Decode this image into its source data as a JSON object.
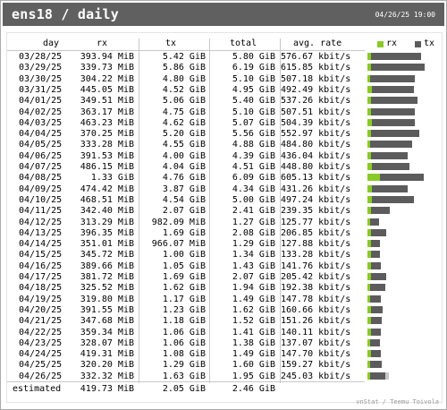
{
  "header": {
    "title": "ens18 / daily",
    "timestamp": "04/26/25 19:00"
  },
  "columns": {
    "day": "day",
    "rx": "rx",
    "tx": "tx",
    "total": "total",
    "avg_rate": "avg. rate"
  },
  "legend": {
    "rx": "rx",
    "tx": "tx",
    "rx_color": "#8aca28",
    "tx_color": "#5c5c5c"
  },
  "rows": [
    {
      "day": "03/28/25",
      "rx": "393.94 MiB",
      "tx": "5.42 GiB",
      "total": "5.80 GiB",
      "rate": "576.67 kbit/s",
      "rx_frac": 0.034,
      "tx_frac": 0.46
    },
    {
      "day": "03/29/25",
      "rx": "339.73 MiB",
      "tx": "5.86 GiB",
      "total": "6.19 GiB",
      "rate": "615.85 kbit/s",
      "rx_frac": 0.029,
      "tx_frac": 0.5
    },
    {
      "day": "03/30/25",
      "rx": "304.22 MiB",
      "tx": "4.80 GiB",
      "total": "5.10 GiB",
      "rate": "507.18 kbit/s",
      "rx_frac": 0.026,
      "tx_frac": 0.41
    },
    {
      "day": "03/31/25",
      "rx": "445.05 MiB",
      "tx": "4.52 GiB",
      "total": "4.95 GiB",
      "rate": "492.49 kbit/s",
      "rx_frac": 0.038,
      "tx_frac": 0.385
    },
    {
      "day": "04/01/25",
      "rx": "349.51 MiB",
      "tx": "5.06 GiB",
      "total": "5.40 GiB",
      "rate": "537.26 kbit/s",
      "rx_frac": 0.03,
      "tx_frac": 0.43
    },
    {
      "day": "04/02/25",
      "rx": "363.17 MiB",
      "tx": "4.75 GiB",
      "total": "5.10 GiB",
      "rate": "507.51 kbit/s",
      "rx_frac": 0.031,
      "tx_frac": 0.405
    },
    {
      "day": "04/03/25",
      "rx": "463.23 MiB",
      "tx": "4.62 GiB",
      "total": "5.07 GiB",
      "rate": "504.39 kbit/s",
      "rx_frac": 0.039,
      "tx_frac": 0.394
    },
    {
      "day": "04/04/25",
      "rx": "370.25 MiB",
      "tx": "5.20 GiB",
      "total": "5.56 GiB",
      "rate": "552.97 kbit/s",
      "rx_frac": 0.032,
      "tx_frac": 0.443
    },
    {
      "day": "04/05/25",
      "rx": "333.28 MiB",
      "tx": "4.55 GiB",
      "total": "4.88 GiB",
      "rate": "484.80 kbit/s",
      "rx_frac": 0.028,
      "tx_frac": 0.388
    },
    {
      "day": "04/06/25",
      "rx": "391.53 MiB",
      "tx": "4.00 GiB",
      "total": "4.39 GiB",
      "rate": "436.04 kbit/s",
      "rx_frac": 0.033,
      "tx_frac": 0.341
    },
    {
      "day": "04/07/25",
      "rx": "486.15 MiB",
      "tx": "4.04 GiB",
      "total": "4.51 GiB",
      "rate": "448.80 kbit/s",
      "rx_frac": 0.041,
      "tx_frac": 0.344
    },
    {
      "day": "04/08/25",
      "rx": "1.33 GiB",
      "tx": "4.76 GiB",
      "total": "6.09 GiB",
      "rate": "605.13 kbit/s",
      "rx_frac": 0.113,
      "tx_frac": 0.406
    },
    {
      "day": "04/09/25",
      "rx": "474.42 MiB",
      "tx": "3.87 GiB",
      "total": "4.34 GiB",
      "rate": "431.26 kbit/s",
      "rx_frac": 0.04,
      "tx_frac": 0.33
    },
    {
      "day": "04/10/25",
      "rx": "468.51 MiB",
      "tx": "4.54 GiB",
      "total": "5.00 GiB",
      "rate": "497.24 kbit/s",
      "rx_frac": 0.04,
      "tx_frac": 0.387
    },
    {
      "day": "04/11/25",
      "rx": "342.40 MiB",
      "tx": "2.07 GiB",
      "total": "2.41 GiB",
      "rate": "239.35 kbit/s",
      "rx_frac": 0.029,
      "tx_frac": 0.177
    },
    {
      "day": "04/12/25",
      "rx": "313.29 MiB",
      "tx": "982.09 MiB",
      "total": "1.27 GiB",
      "rate": "125.77 kbit/s",
      "rx_frac": 0.026,
      "tx_frac": 0.082
    },
    {
      "day": "04/13/25",
      "rx": "396.35 MiB",
      "tx": "1.69 GiB",
      "total": "2.08 GiB",
      "rate": "206.85 kbit/s",
      "rx_frac": 0.033,
      "tx_frac": 0.144
    },
    {
      "day": "04/14/25",
      "rx": "351.01 MiB",
      "tx": "966.07 MiB",
      "total": "1.29 GiB",
      "rate": "127.88 kbit/s",
      "rx_frac": 0.03,
      "tx_frac": 0.08
    },
    {
      "day": "04/15/25",
      "rx": "345.72 MiB",
      "tx": "1.00 GiB",
      "total": "1.34 GiB",
      "rate": "133.28 kbit/s",
      "rx_frac": 0.029,
      "tx_frac": 0.085
    },
    {
      "day": "04/16/25",
      "rx": "389.66 MiB",
      "tx": "1.05 GiB",
      "total": "1.43 GiB",
      "rate": "141.76 kbit/s",
      "rx_frac": 0.033,
      "tx_frac": 0.09
    },
    {
      "day": "04/17/25",
      "rx": "381.72 MiB",
      "tx": "1.69 GiB",
      "total": "2.07 GiB",
      "rate": "205.42 kbit/s",
      "rx_frac": 0.032,
      "tx_frac": 0.144
    },
    {
      "day": "04/18/25",
      "rx": "325.52 MiB",
      "tx": "1.62 GiB",
      "total": "1.94 GiB",
      "rate": "192.38 kbit/s",
      "rx_frac": 0.028,
      "tx_frac": 0.138
    },
    {
      "day": "04/19/25",
      "rx": "319.80 MiB",
      "tx": "1.17 GiB",
      "total": "1.49 GiB",
      "rate": "147.78 kbit/s",
      "rx_frac": 0.027,
      "tx_frac": 0.1
    },
    {
      "day": "04/20/25",
      "rx": "391.55 MiB",
      "tx": "1.23 GiB",
      "total": "1.62 GiB",
      "rate": "160.66 kbit/s",
      "rx_frac": 0.033,
      "tx_frac": 0.105
    },
    {
      "day": "04/21/25",
      "rx": "347.68 MiB",
      "tx": "1.18 GiB",
      "total": "1.52 GiB",
      "rate": "151.26 kbit/s",
      "rx_frac": 0.03,
      "tx_frac": 0.1
    },
    {
      "day": "04/22/25",
      "rx": "359.34 MiB",
      "tx": "1.06 GiB",
      "total": "1.41 GiB",
      "rate": "140.11 kbit/s",
      "rx_frac": 0.031,
      "tx_frac": 0.09
    },
    {
      "day": "04/23/25",
      "rx": "328.07 MiB",
      "tx": "1.06 GiB",
      "total": "1.38 GiB",
      "rate": "137.07 kbit/s",
      "rx_frac": 0.028,
      "tx_frac": 0.09
    },
    {
      "day": "04/24/25",
      "rx": "419.31 MiB",
      "tx": "1.08 GiB",
      "total": "1.49 GiB",
      "rate": "147.70 kbit/s",
      "rx_frac": 0.036,
      "tx_frac": 0.092
    },
    {
      "day": "04/25/25",
      "rx": "320.20 MiB",
      "tx": "1.29 GiB",
      "total": "1.60 GiB",
      "rate": "159.27 kbit/s",
      "rx_frac": 0.027,
      "tx_frac": 0.11
    },
    {
      "day": "04/26/25",
      "rx": "332.32 MiB",
      "tx": "1.63 GiB",
      "total": "1.95 GiB",
      "rate": "245.03 kbit/s",
      "rx_frac": 0.028,
      "tx_frac": 0.139
    }
  ],
  "estimated": {
    "label": "estimated",
    "rx": "419.73 MiB",
    "tx": "2.05 GiB",
    "total": "2.46 GiB",
    "est_tx_frac": 0.175
  },
  "footer": "vnStat / Teemu Toivola"
}
